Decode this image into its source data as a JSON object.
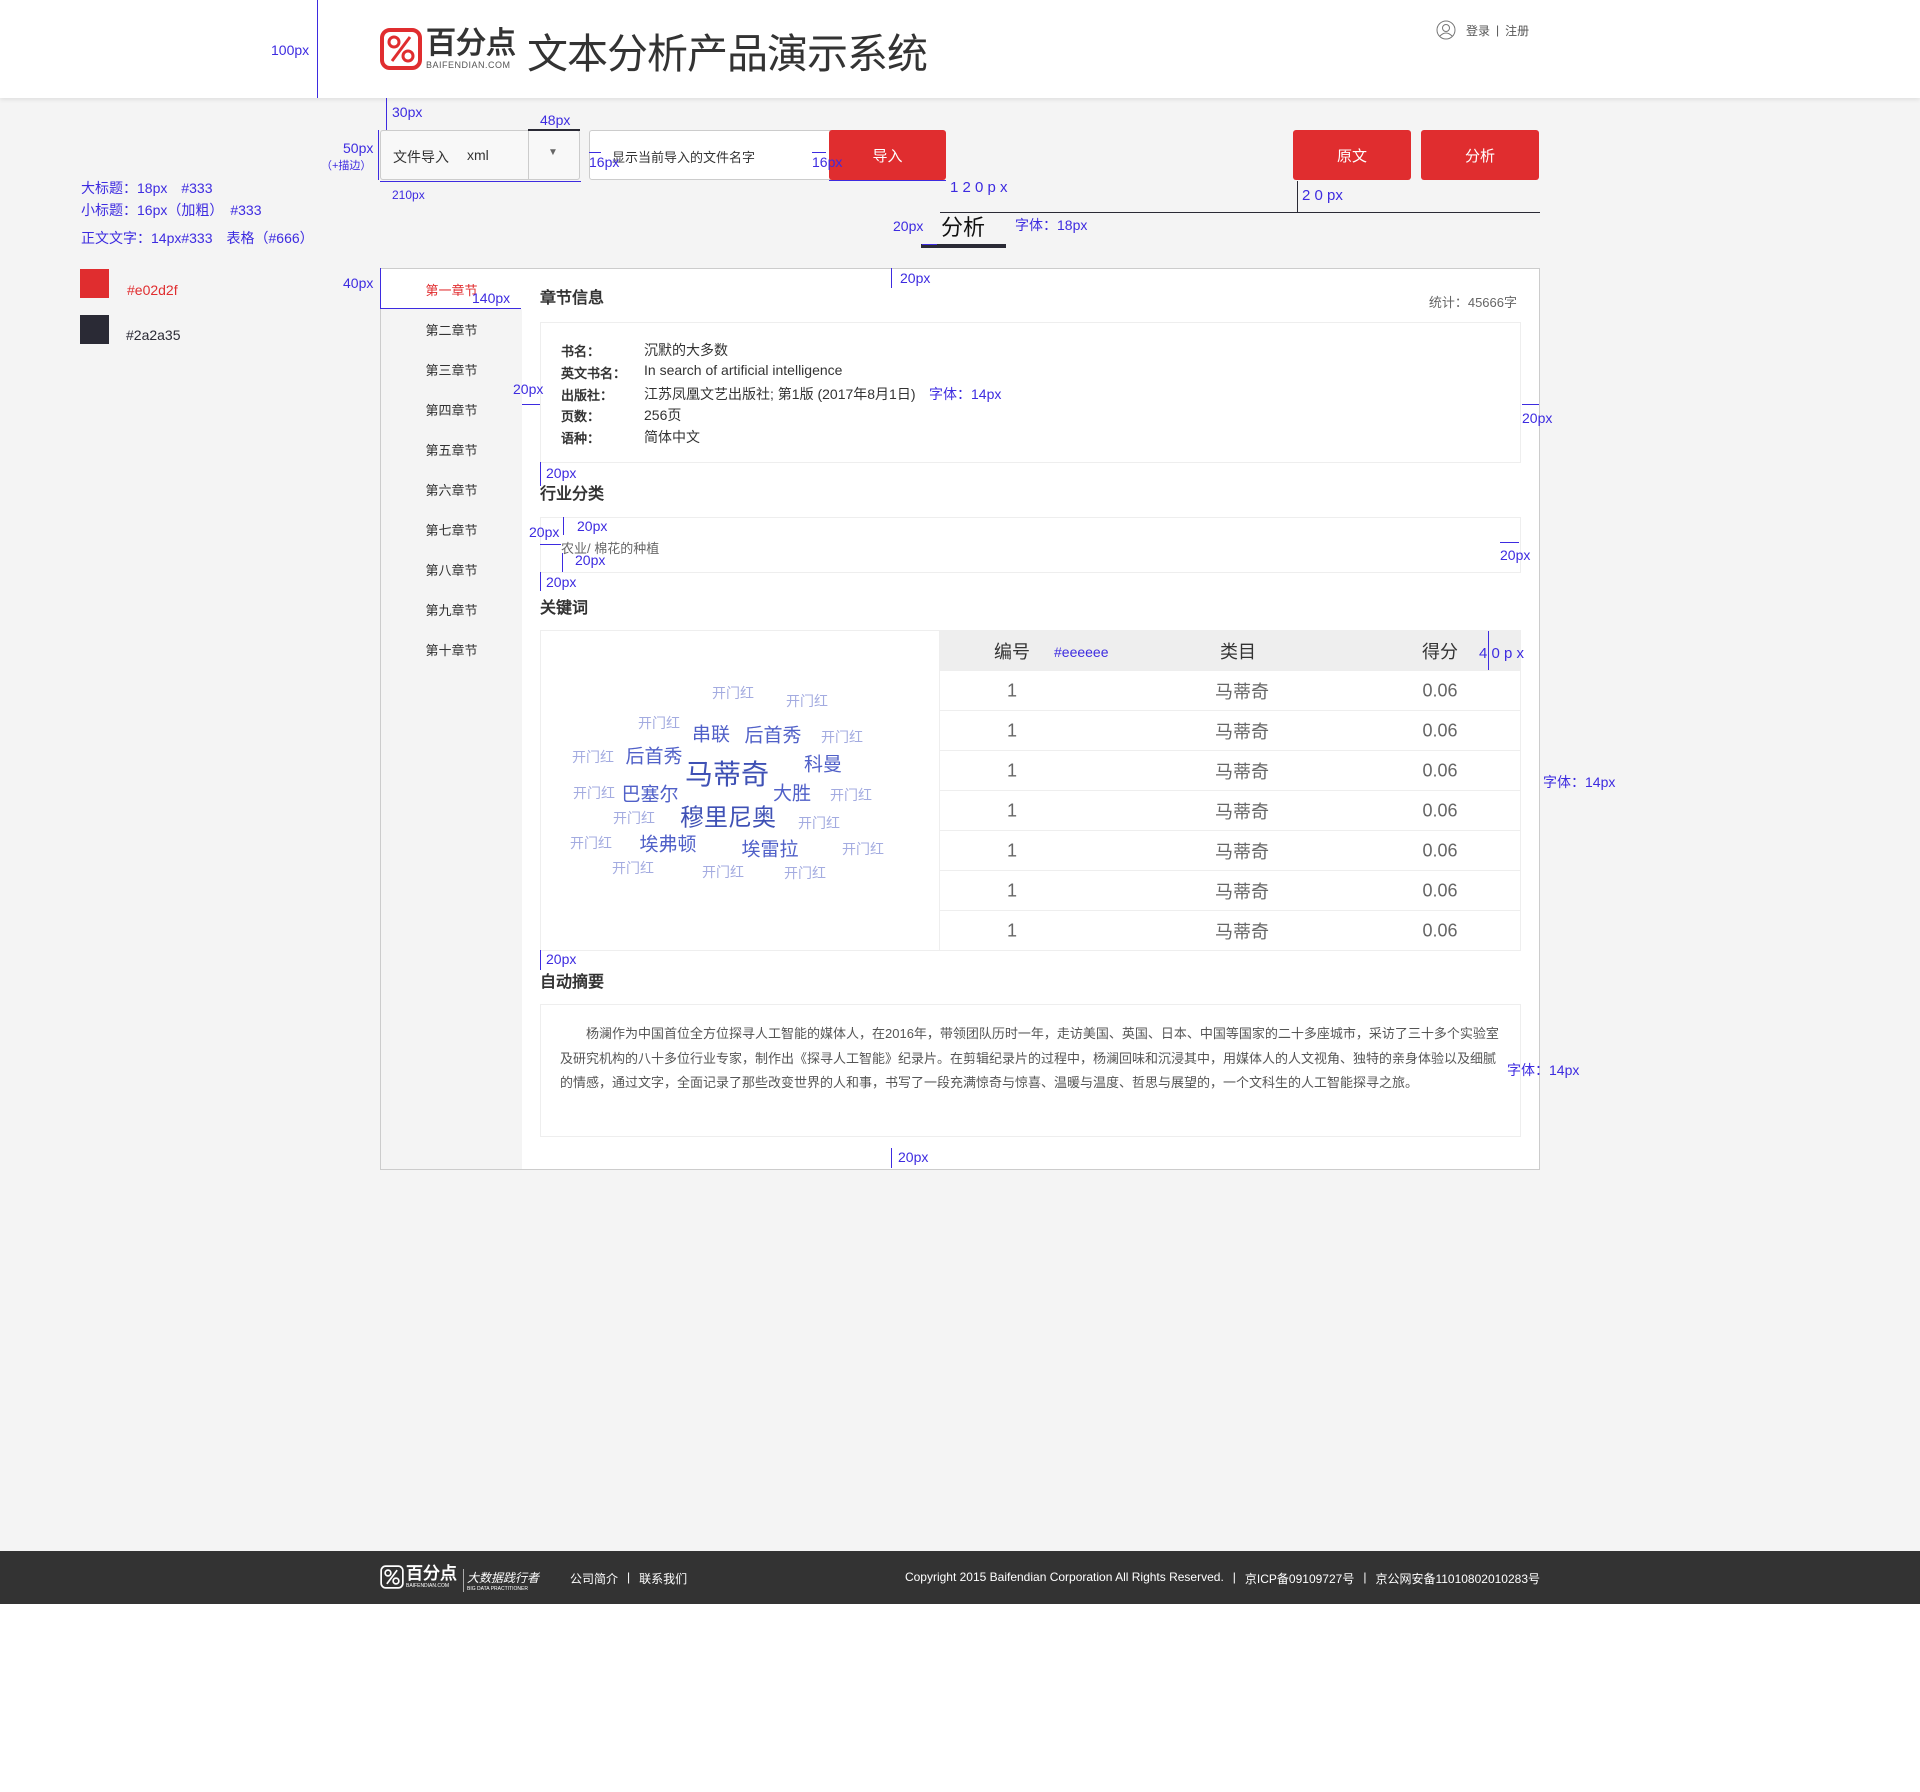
{
  "header": {
    "brand": "百分点",
    "brand_sub": "BAIFENDIAN.COM",
    "title": "文本分析产品演示系统",
    "login": "登录",
    "separator": "|",
    "register": "注册"
  },
  "toolbar": {
    "file_import_label": "文件导入",
    "file_type": "xml",
    "dropdown_arrow": "▼",
    "filename_placeholder": "显示当前导入的文件名字",
    "import_button": "导入",
    "original_button": "原文",
    "analysis_button": "分析",
    "active_tab": "分析"
  },
  "colors": {
    "accent": "#e02d2f",
    "dark": "#2a2a35",
    "table_header": "#eeeeee",
    "annotation": "#3d2be0"
  },
  "legend": {
    "big_title": "大标题：18px　#333",
    "small_title": "小标题：16px（加粗）　#333",
    "body": "正文文字：14px#333　表格（#666）",
    "red_swatch": "#e02d2f",
    "dark_swatch": "#2a2a35"
  },
  "annotations": {
    "a100": "100px",
    "a30": "30px",
    "a48": "48px",
    "a50": "50px",
    "a50b": "（+描边）",
    "a210": "210px",
    "a16a": "16px",
    "a16b": "16px",
    "a120": "1 2 0 p x",
    "a20tb": "2 0 px",
    "a20tab": "20px",
    "font18": "字体：18px",
    "a40": "40px",
    "a140": "140px",
    "a20top": "20px",
    "a20info": "20px",
    "font14a": "字体：14px",
    "a20r1": "20px",
    "a20h2": "20px",
    "a20ind_l": "20px",
    "a20ind_t": "20px",
    "a20ind_b": "20px",
    "a20r2": "20px",
    "a20h3": "20px",
    "eeeeee": "#eeeeee",
    "a40row": "4 0 p x",
    "font14b": "字体：14px",
    "a20h4": "20px",
    "font14c": "字体：14px",
    "a20bottom": "20px"
  },
  "sidebar": {
    "items": [
      {
        "label": "第一章节"
      },
      {
        "label": "第二章节"
      },
      {
        "label": "第三章节"
      },
      {
        "label": "第四章节"
      },
      {
        "label": "第五章节"
      },
      {
        "label": "第六章节"
      },
      {
        "label": "第七章节"
      },
      {
        "label": "第八章节"
      },
      {
        "label": "第九章节"
      },
      {
        "label": "第十章节"
      }
    ]
  },
  "chapter_info": {
    "title": "章节信息",
    "stats": "统计：45666字",
    "fields": [
      {
        "label": "书名：",
        "value": "沉默的大多数"
      },
      {
        "label": "英文书名：",
        "value": "In search of artificial intelligence"
      },
      {
        "label": "出版社：",
        "value": "江苏凤凰文艺出版社; 第1版 (2017年8月1日)"
      },
      {
        "label": "页数：",
        "value": "256页"
      },
      {
        "label": "语种：",
        "value": "简体中文"
      }
    ]
  },
  "industry": {
    "title": "行业分类",
    "value": "农业/ 棉花的种植"
  },
  "keywords": {
    "title": "关键词",
    "cloud": [
      {
        "text": "开门红"
      },
      {
        "text": "开门红"
      },
      {
        "text": "开门红"
      },
      {
        "text": "串联"
      },
      {
        "text": "后首秀"
      },
      {
        "text": "开门红"
      },
      {
        "text": "开门红"
      },
      {
        "text": "后首秀"
      },
      {
        "text": "马蒂奇"
      },
      {
        "text": "科曼"
      },
      {
        "text": "开门红"
      },
      {
        "text": "巴塞尔"
      },
      {
        "text": "大胜"
      },
      {
        "text": "开门红"
      },
      {
        "text": "开门红"
      },
      {
        "text": "穆里尼奥"
      },
      {
        "text": "开门红"
      },
      {
        "text": "开门红"
      },
      {
        "text": "埃弗顿"
      },
      {
        "text": "埃雷拉"
      },
      {
        "text": "开门红"
      },
      {
        "text": "开门红"
      },
      {
        "text": "开门红"
      },
      {
        "text": "开门红"
      }
    ],
    "table": {
      "headers": [
        "编号",
        "类目",
        "得分"
      ],
      "rows": [
        [
          "1",
          "马蒂奇",
          "0.06"
        ],
        [
          "1",
          "马蒂奇",
          "0.06"
        ],
        [
          "1",
          "马蒂奇",
          "0.06"
        ],
        [
          "1",
          "马蒂奇",
          "0.06"
        ],
        [
          "1",
          "马蒂奇",
          "0.06"
        ],
        [
          "1",
          "马蒂奇",
          "0.06"
        ],
        [
          "1",
          "马蒂奇",
          "0.06"
        ]
      ]
    }
  },
  "summary": {
    "title": "自动摘要",
    "text": "杨澜作为中国首位全方位探寻人工智能的媒体人，在2016年，带领团队历时一年，走访美国、英国、日本、中国等国家的二十多座城市，采访了三十多个实验室及研究机构的八十多位行业专家，制作出《探寻人工智能》纪录片。在剪辑纪录片的过程中，杨澜回味和沉浸其中，用媒体人的人文视角、独特的亲身体验以及细腻的情感，通过文字，全面记录了那些改变世界的人和事，书写了一段充满惊奇与惊喜、温暖与温度、哲思与展望的，一个文科生的人工智能探寻之旅。"
  },
  "footer": {
    "brand": "百分点",
    "brand_sub": "BAIFENDIAN.COM",
    "slogan": "大数据践行者",
    "slogan_sub": "BIG DATA PRACTITIONER",
    "about": "公司简介",
    "contact": "联系我们",
    "sep": "|",
    "copyright": "Copyright 2015 Baifendian Corporation All Rights Reserved.",
    "icp": "京ICP备09109727号",
    "police": "京公网安备11010802010283号"
  }
}
